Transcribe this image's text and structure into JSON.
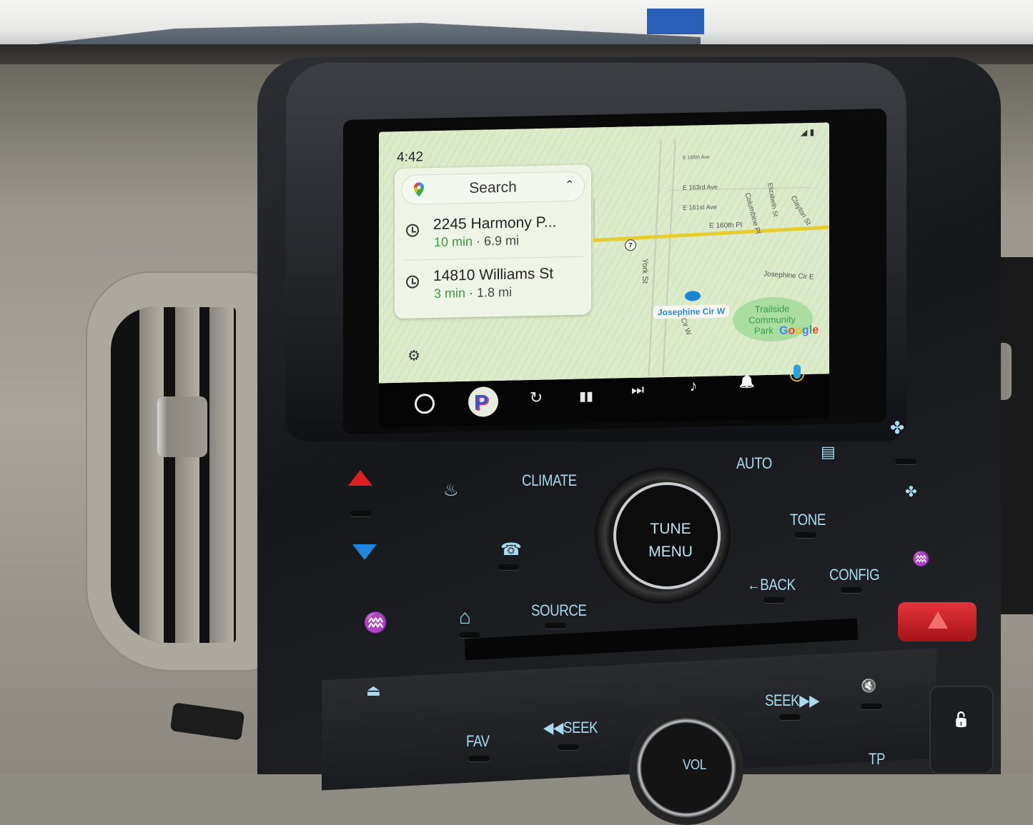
{
  "android_auto": {
    "status_bar": {
      "time": "4:42",
      "signal_icon": "signal-icon",
      "battery_icon": "battery-icon"
    },
    "search_card": {
      "search_label": "Search",
      "maps_icon": "google-maps-pin-icon",
      "collapse_icon": "chevron-up-icon",
      "destinations": [
        {
          "icon": "clock-icon",
          "name": "2245 Harmony P...",
          "eta": "10 min",
          "separator": " · ",
          "distance": "6.9 mi"
        },
        {
          "icon": "clock-icon",
          "name": "14810 Williams St",
          "eta": "3 min",
          "separator": " · ",
          "distance": "1.8 mi"
        }
      ],
      "settings_icon": "gear-icon"
    },
    "map": {
      "streets": [
        "E 165th Ave",
        "E 163rd Ave",
        "E 161st Ave",
        "E 160th Pl",
        "York St",
        "Columbine Pl",
        "Elizabeth St",
        "Clayton St",
        "Josephine Cir E",
        "Cir W"
      ],
      "highway_shield": "7",
      "selected_street": "Josephine Cir W",
      "park_label": [
        "Trailside",
        "Community",
        "Park"
      ],
      "attribution": "Google",
      "colors": {
        "highway": "#e7cc2e",
        "park": "#a9dea0",
        "place": "#1a84d4",
        "eta": "#3a9a3a"
      }
    },
    "nav_bar": [
      {
        "name": "home-button",
        "icon": "circle-home-icon"
      },
      {
        "name": "pandora-app",
        "icon": "pandora-icon",
        "glyph": "P"
      },
      {
        "name": "replay-button",
        "icon": "replay-icon",
        "glyph": "↻"
      },
      {
        "name": "pause-button",
        "icon": "pause-icon",
        "glyph": "▮▮"
      },
      {
        "name": "skip-next-button",
        "icon": "skip-next-icon",
        "glyph": "⏭"
      },
      {
        "name": "music-button",
        "icon": "music-note-icon",
        "glyph": "♪"
      },
      {
        "name": "notifications-button",
        "icon": "bell-icon",
        "glyph": "🔔"
      },
      {
        "name": "voice-button",
        "icon": "microphone-icon"
      }
    ]
  },
  "car_controls": {
    "climate": "CLIMATE",
    "auto": "AUTO",
    "tune": "TUNE",
    "menu": "MENU",
    "tone": "TONE",
    "back": "←BACK",
    "config": "CONFIG",
    "source": "SOURCE",
    "fav": "FAV",
    "seek_back": "◀◀SEEK",
    "seek_fwd": "SEEK▶▶",
    "vol": "VOL",
    "tp": "TP",
    "icons": {
      "temp_up": "temperature-up-icon",
      "temp_down": "temperature-down-icon",
      "front_defrost": "front-defrost-icon",
      "rear_defrost": "rear-defrost-icon",
      "phone": "phone-icon",
      "home": "home-icon",
      "seat_heat_left": "heated-seat-icon",
      "seat_heat_right": "heated-seat-icon",
      "fan_high": "fan-icon",
      "fan_low": "fan-icon",
      "eject": "eject-icon",
      "mute": "mute-icon",
      "hazard": "hazard-icon",
      "unlock": "unlock-icon"
    },
    "glyphs": {
      "front_defrost": "♨",
      "rear_defrost": "▤",
      "phone": "☎",
      "home": "⌂",
      "seat": "♒",
      "fan": "✤",
      "eject": "⏏",
      "mute": "🔇",
      "unlock": "🔓"
    },
    "colors": {
      "label": "#a8dbf0",
      "temp_up": "#e02020",
      "temp_down": "#1e86dd",
      "hazard": "#e6343a"
    }
  }
}
